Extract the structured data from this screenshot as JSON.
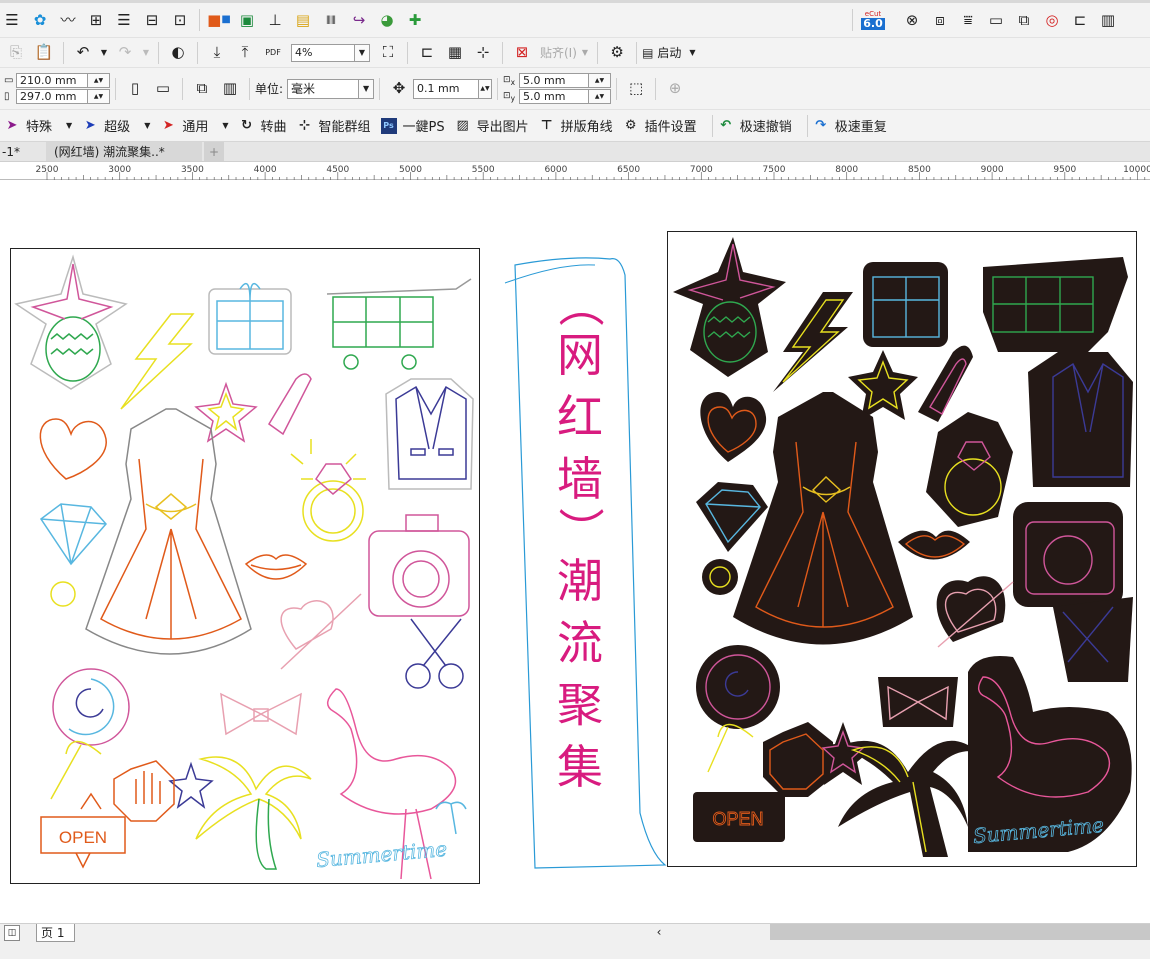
{
  "toolbar1": {
    "icons": [
      "menu-icon",
      "cdr-blue-icon",
      "curve-tool-icon",
      "align-icon",
      "line-icon",
      "layout-icon",
      "grid-select-icon",
      "color-blocks-icon",
      "image-frame-icon",
      "text-icon",
      "gold-bars-icon",
      "barcode-icon",
      "arrow-curve-icon",
      "globe-icon",
      "puzzle-icon"
    ],
    "ecut_badge_top": "eCut",
    "ecut_badge_num": "6.0",
    "right_icons": [
      "ring-icon",
      "print-cube-icon",
      "ruler-icon",
      "tape-icon",
      "stack-icon",
      "target-icon",
      "drill-icon",
      "grid-window-icon"
    ]
  },
  "toolbar2": {
    "pdf_label": "PDF",
    "zoom_value": "4%",
    "align_label": "贴齐(I)",
    "launch_label": "启动"
  },
  "toolbar3": {
    "width_value": "210.0 mm",
    "height_value": "297.0 mm",
    "unit_label": "单位:",
    "unit_value": "毫米",
    "nudge_value": "0.1 mm",
    "dup_x_value": "5.0 mm",
    "dup_y_value": "5.0 mm",
    "x_sub": "x",
    "y_sub": "y"
  },
  "toolbar4": {
    "items": [
      {
        "label": "特殊",
        "icon": "pen-icon",
        "color": "#8b1a8b",
        "dropdown": true
      },
      {
        "label": "超级",
        "icon": "pen-icon",
        "color": "#1d3db8",
        "dropdown": true
      },
      {
        "label": "通用",
        "icon": "pen-icon",
        "color": "#d32424",
        "dropdown": true
      },
      {
        "label": "转曲",
        "icon": "rotate-dotted-icon",
        "color": "#333333",
        "dropdown": false
      },
      {
        "label": "智能群组",
        "icon": "group-icon",
        "color": "#333333",
        "dropdown": false
      },
      {
        "label": "一鍵PS",
        "icon": "ps-icon",
        "color": "#1f3a7a",
        "dropdown": false
      },
      {
        "label": "导出图片",
        "icon": "image-icon",
        "color": "#333333",
        "dropdown": false
      },
      {
        "label": "拼版角线",
        "icon": "crop-mark-icon",
        "color": "#333333",
        "dropdown": false
      },
      {
        "label": "插件设置",
        "icon": "gear-icon",
        "color": "#111111",
        "dropdown": false
      },
      {
        "label": "极速撤销",
        "icon": "undo-icon",
        "color": "#1c8a3c",
        "dropdown": false
      },
      {
        "label": "极速重复",
        "icon": "redo-icon",
        "color": "#1a6fd0",
        "dropdown": false
      }
    ]
  },
  "tabs": {
    "left_partial": "-1*",
    "active": "(网红墙) 潮流聚集..*",
    "add": "+"
  },
  "ruler": {
    "ticks": [
      "2500",
      "3000",
      "3500",
      "4000",
      "4500",
      "5000",
      "5500",
      "6000",
      "6500",
      "7000",
      "7500",
      "8000",
      "8500",
      "9000",
      "9500",
      "10000"
    ]
  },
  "canvas": {
    "title_chars": [
      "（",
      "网",
      "红",
      "墙",
      "）",
      "潮",
      "流",
      "聚",
      "集"
    ],
    "title_color": "#d81b7f",
    "frame_color": "#2a9ad6",
    "left_sheet_items": [
      "pineapple",
      "lightning",
      "gift",
      "shopping-cart",
      "heart",
      "star",
      "lipstick",
      "suit",
      "dress",
      "diamond-ring",
      "diamond",
      "lips",
      "camera",
      "circle",
      "heart-arrow",
      "scissors",
      "lollipop",
      "bow",
      "star-small",
      "stop-hand",
      "palm-tree",
      "flamingo",
      "open-sign"
    ],
    "open_text": "OPEN",
    "summertime_text": "Summertime"
  },
  "status": {
    "page_label": "页 1"
  }
}
